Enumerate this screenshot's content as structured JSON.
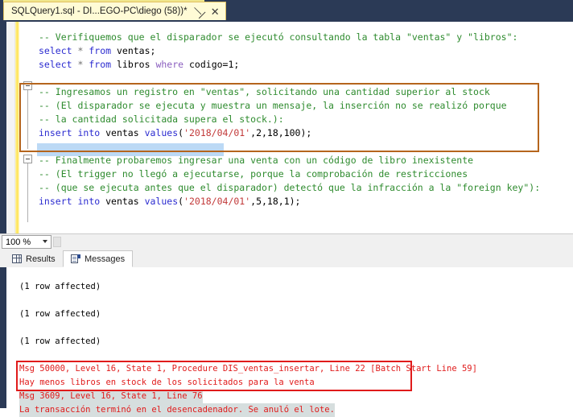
{
  "window": {
    "tab_title": "SQLQuery1.sql - DI...EGO-PC\\diego (58))*",
    "pin_icon": "pin-icon",
    "close_icon": "close-icon"
  },
  "editor": {
    "lines": [
      {
        "text": "-- Verifiquemos que el disparador se ejecutó consultando la tabla \"ventas\" y \"libros\":",
        "type": "comment"
      },
      {
        "text": "select * from ventas;",
        "type": "sql"
      },
      {
        "text": "select * from libros where codigo=1;",
        "type": "sql"
      },
      {
        "text": "",
        "type": "blank"
      },
      {
        "text": "-- Ingresamos un registro en \"ventas\", solicitando una cantidad superior al stock",
        "type": "comment"
      },
      {
        "text": "-- (El disparador se ejecuta y muestra un mensaje, la inserción no se realizó porque",
        "type": "comment"
      },
      {
        "text": "-- la cantidad solicitada supera el stock.):",
        "type": "comment"
      },
      {
        "text": "insert into ventas values('2018/04/01',2,18,100);",
        "type": "sql-selected"
      },
      {
        "text": "",
        "type": "blank"
      },
      {
        "text": "-- Finalmente probaremos ingresar una venta con un código de libro inexistente",
        "type": "comment"
      },
      {
        "text": "-- (El trigger no llegó a ejecutarse, porque la comprobación de restricciones",
        "type": "comment"
      },
      {
        "text": "-- (que se ejecuta antes que el disparador) detectó que la infracción a la \"foreign key\"):",
        "type": "comment"
      },
      {
        "text": "insert into ventas values('2018/04/01',5,18,1);",
        "type": "sql"
      }
    ],
    "keywords": [
      "select",
      "from",
      "where",
      "insert",
      "into",
      "values"
    ],
    "highlight_box_color": "#b5651d"
  },
  "zoombar": {
    "zoom_level": "100 %",
    "dropdown_icon": "chevron-down-icon"
  },
  "result_tabs": [
    {
      "label": "Results",
      "icon": "grid-icon",
      "active": false
    },
    {
      "label": "Messages",
      "icon": "messages-icon",
      "active": true
    }
  ],
  "messages": {
    "lines": [
      {
        "text": "(1 row affected)",
        "style": "normal"
      },
      {
        "text": "",
        "style": "blank"
      },
      {
        "text": "(1 row affected)",
        "style": "normal"
      },
      {
        "text": "",
        "style": "blank"
      },
      {
        "text": "(1 row affected)",
        "style": "normal"
      },
      {
        "text": "",
        "style": "blank"
      },
      {
        "text": "Msg 50000, Level 16, State 1, Procedure DIS_ventas_insertar, Line 22 [Batch Start Line 59]",
        "style": "error"
      },
      {
        "text": "Hay menos libros en stock de los solicitados para la venta",
        "style": "error"
      },
      {
        "text": "Msg 3609, Level 16, State 1, Line 76",
        "style": "error-selected"
      },
      {
        "text": "La transacción terminó en el desencadenador. Se anuló el lote.",
        "style": "error-selected"
      }
    ],
    "highlight_box_color": "#e01b1b"
  },
  "colors": {
    "navy_edge": "#2b3a56",
    "tab_yellow": "#fffbd6",
    "comment_green": "#2e8b2e",
    "keyword_blue": "#2b2bd0",
    "string_red": "#c23a3a",
    "error_red": "#e01b1b",
    "selection_blue": "#bcd9f5",
    "change_bar_yellow": "#ffe86b"
  }
}
